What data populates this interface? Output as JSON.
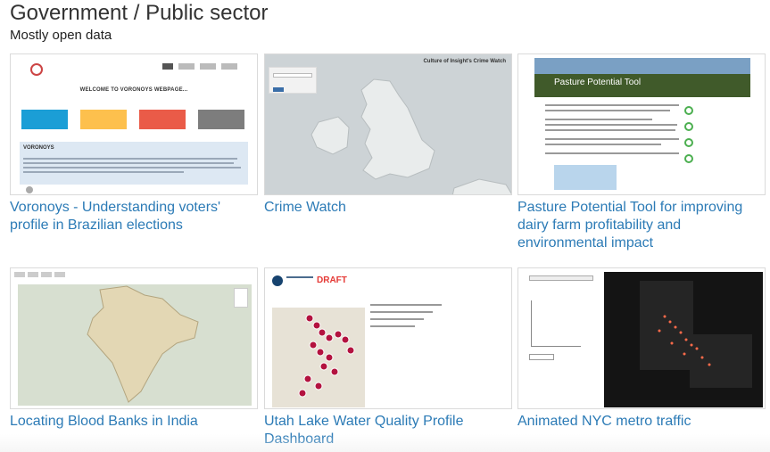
{
  "section": {
    "title": "Government / Public sector",
    "subtitle": "Mostly open data"
  },
  "cards": [
    {
      "title": "Voronoys - Understanding voters' profile in Brazilian elections",
      "thumb_text": "WELCOME TO VORONOYS WEBPAGE..."
    },
    {
      "title": "Crime Watch",
      "thumb_text": "Culture of Insight's Crime Watch"
    },
    {
      "title": "Pasture Potential Tool for improving dairy farm profitability and environmental impact",
      "thumb_text": "Pasture Potential Tool"
    },
    {
      "title": "Locating Blood Banks in India"
    },
    {
      "title": "Utah Lake Water Quality Profile Dashboard",
      "thumb_text": "DRAFT"
    },
    {
      "title": "Animated NYC metro traffic"
    }
  ],
  "colors": {
    "link": "#2c7bb6",
    "voronoys_boxes": [
      "#1b9ed6",
      "#fdc04d",
      "#ea5b48",
      "#7d7d7d"
    ],
    "draft": "#e53935"
  }
}
